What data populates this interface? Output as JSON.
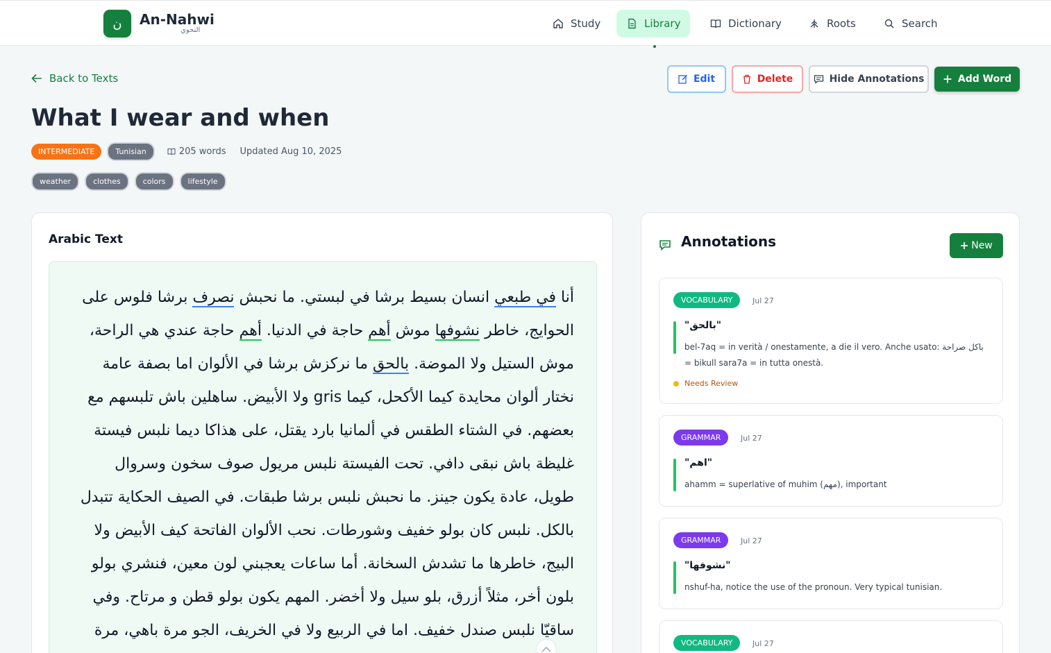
{
  "app": {
    "logo_glyph": "ن",
    "name": "An-Nahwi",
    "name_arabic": "النحوي"
  },
  "nav": {
    "items": [
      {
        "label": "Study",
        "icon": "home-icon",
        "active": false
      },
      {
        "label": "Library",
        "icon": "document-icon",
        "active": true
      },
      {
        "label": "Dictionary",
        "icon": "book-icon",
        "active": false
      },
      {
        "label": "Roots",
        "icon": "tree-roots-icon",
        "active": false
      },
      {
        "label": "Search",
        "icon": "search-icon",
        "active": false
      }
    ]
  },
  "toolbar": {
    "back_label": "Back to Texts",
    "edit_label": "Edit",
    "delete_label": "Delete",
    "hide_annotations_label": "Hide Annotations",
    "add_word_label": "Add Word"
  },
  "text": {
    "title": "What I wear and when",
    "level": "INTERMEDIATE",
    "dialect": "Tunisian",
    "word_count": "205 words",
    "updated": "Updated Aug 10, 2025",
    "tags": [
      "weather",
      "clothes",
      "colors",
      "lifestyle"
    ],
    "card_title": "Arabic Text"
  },
  "annotations_panel": {
    "title": "Annotations",
    "new_label": "New",
    "items": [
      {
        "type": "VOCABULARY",
        "date": "Jul 27",
        "word": "\"بالحق\"",
        "note": "bel-7aq = in verità / onestamente, a die il vero. Anche usato: باكل صراحة = bikull sara7a = in tutta onestà.",
        "status": "Needs Review"
      },
      {
        "type": "GRAMMAR",
        "date": "Jul 27",
        "word": "\"اهم\"",
        "note": "ahamm = superlative of muhim (مهم), important"
      },
      {
        "type": "GRAMMAR",
        "date": "Jul 27",
        "word": "\"نشوفها\"",
        "note": "nshuf-ha, notice the use of the pronoun. Very typical tunisian."
      },
      {
        "type": "VOCABULARY",
        "date": "Jul 27"
      }
    ]
  },
  "colors": {
    "brand": "#15803d",
    "vocabulary": "#10b981",
    "grammar": "#7c3aed",
    "level_badge": "#f97316"
  }
}
